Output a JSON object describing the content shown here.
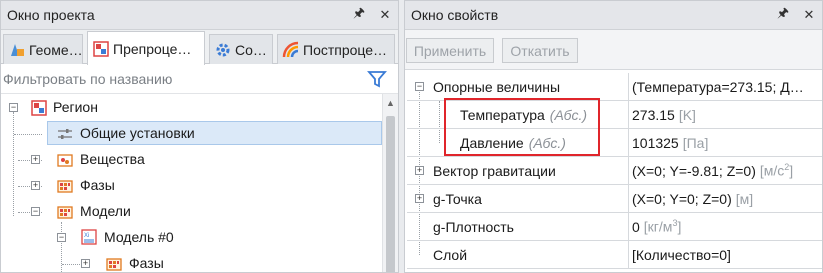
{
  "left_panel": {
    "title": "Окно проекта",
    "pin_icon": "pin-icon",
    "close_icon": "close-icon",
    "tabs": [
      {
        "label": "Геоме…",
        "icon": "geometry-icon",
        "active": false
      },
      {
        "label": "Препроце…",
        "icon": "preprocess-icon",
        "active": true
      },
      {
        "label": "Со…",
        "icon": "gear-icon",
        "active": false
      },
      {
        "label": "Постпроце…",
        "icon": "postprocess-icon",
        "active": false
      }
    ],
    "filter_placeholder": "Фильтровать по названию",
    "filter_icon": "filter-icon",
    "tree": [
      {
        "label": "Регион",
        "expander": "−",
        "icon": "region-icon"
      },
      {
        "label": "Общие установки",
        "expander": "",
        "icon": "settings-sliders-icon",
        "selected": true
      },
      {
        "label": "Вещества",
        "expander": "+",
        "icon": "substances-icon"
      },
      {
        "label": "Фазы",
        "expander": "+",
        "icon": "phases-icon"
      },
      {
        "label": "Модели",
        "expander": "−",
        "icon": "models-icon"
      },
      {
        "label": "Модель #0",
        "expander": "−",
        "icon": "model-icon"
      },
      {
        "label": "Фазы",
        "expander": "+",
        "icon": "phases-icon"
      }
    ]
  },
  "right_panel": {
    "title": "Окно свойств",
    "buttons": {
      "apply": "Применить",
      "revert": "Откатить"
    },
    "rows": [
      {
        "name": "Опорные величины",
        "expander": "−",
        "value": "(Температура=273.15; Д…",
        "unit": ""
      },
      {
        "name": "Температура",
        "qualifier": "(Абс.)",
        "value": "273.15",
        "unit": "[K]"
      },
      {
        "name": "Давление",
        "qualifier": "(Абс.)",
        "value": "101325",
        "unit": "[Па]"
      },
      {
        "name": "Вектор гравитации",
        "expander": "+",
        "value": "(X=0; Y=-9.81; Z=0)",
        "unit": "[м/с",
        "unit_sup": "2",
        "unit_end": "]"
      },
      {
        "name": "g-Точка",
        "expander": "+",
        "value": "(X=0; Y=0; Z=0)",
        "unit": "[м]"
      },
      {
        "name": "g-Плотность",
        "value": "0",
        "unit": "[кг/м",
        "unit_sup": "3",
        "unit_end": "]"
      },
      {
        "name": "Слой",
        "value": "[Количество=0]",
        "unit": ""
      }
    ]
  },
  "colors": {
    "highlight_box": "#e0252b",
    "selection": "#dbe9f8"
  }
}
